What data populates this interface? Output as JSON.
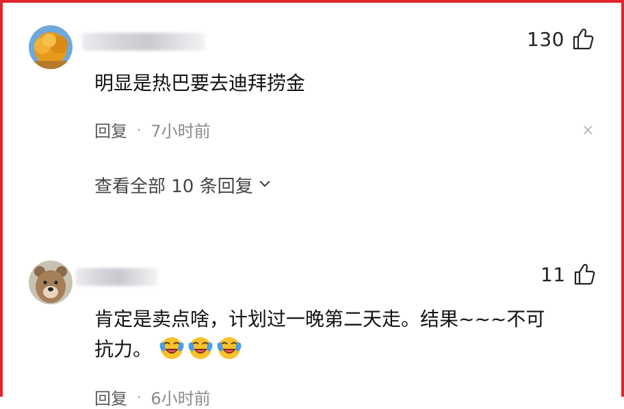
{
  "comments": [
    {
      "likes": "130",
      "text": "明显是热巴要去迪拜捞金",
      "reply_label": "回复",
      "separator": "·",
      "time": "7小时前",
      "close_glyph": "×",
      "view_replies": "查看全部 10 条回复",
      "avatar_icon": "tree-avatar-icon"
    },
    {
      "likes": "11",
      "text_line1": "肯定是卖点啥，计划过一晚第二天走。结果~~~不可",
      "text_line2": "抗力。",
      "emoji_count": 3,
      "emoji_icon": "laughing-crying-emoji",
      "reply_label": "回复",
      "separator": "·",
      "time": "6小时前",
      "avatar_icon": "bear-avatar-icon"
    }
  ],
  "colors": {
    "frame": "#e0262b",
    "emoji_face": "#f7c22b",
    "emoji_tear": "#4a9ee8"
  }
}
